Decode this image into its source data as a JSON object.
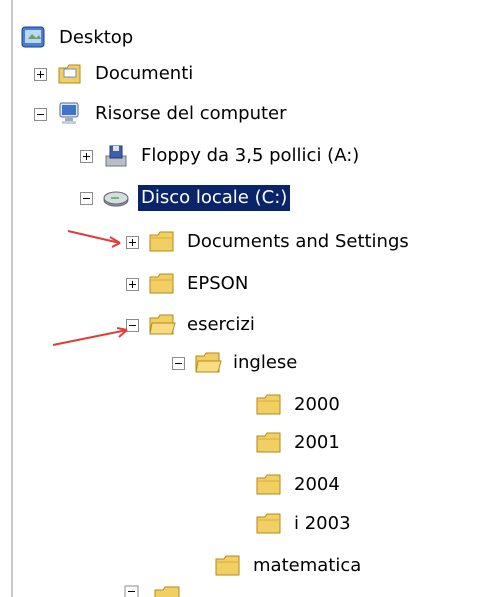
{
  "tree": {
    "desktop": "Desktop",
    "documenti": "Documenti",
    "risorse": "Risorse del computer",
    "floppy": "Floppy da 3,5 pollici (A:)",
    "disco": "Disco locale (C:)",
    "docs_settings": "Documents and Settings",
    "epson": "EPSON",
    "esercizi": "esercizi",
    "inglese": "inglese",
    "y2000": "2000",
    "y2001": "2001",
    "y2004": "2004",
    "i2003": "i 2003",
    "matematica": "matematica"
  },
  "colors": {
    "selection": "#0a246a",
    "folder": "#f2cf63",
    "arrow": "#e23b3b"
  }
}
